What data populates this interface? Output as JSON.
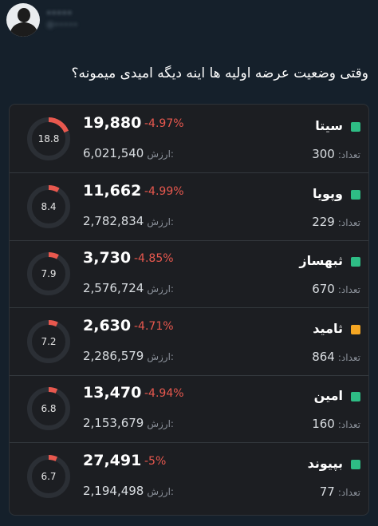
{
  "post": {
    "author_name": "•••••",
    "author_handle": "@•••••",
    "text": "وقتی وضعیت عرضه اولیه ها اینه دیگه امیدی میمونه؟"
  },
  "labels": {
    "value": "ارزش:",
    "count": "تعداد:"
  },
  "colors": {
    "green": "#2ebd85",
    "orange": "#f5a623",
    "red": "#e8584e",
    "track": "#2b2f35"
  },
  "stocks": [
    {
      "name": "سیتا",
      "status": "green",
      "price": "19,880",
      "change": "-4.97%",
      "value": "6,021,540",
      "count": "300",
      "gauge_text": "18.8",
      "gauge_level": 18.8
    },
    {
      "name": "وپویا",
      "status": "green",
      "price": "11,662",
      "change": "-4.99%",
      "value": "2,782,834",
      "count": "229",
      "gauge_text": "8.4",
      "gauge_level": 8.4
    },
    {
      "name": "ثبهساز",
      "status": "green",
      "price": "3,730",
      "change": "-4.85%",
      "value": "2,576,724",
      "count": "670",
      "gauge_text": "7.9",
      "gauge_level": 7.9
    },
    {
      "name": "ثامید",
      "status": "orange",
      "price": "2,630",
      "change": "-4.71%",
      "value": "2,286,579",
      "count": "864",
      "gauge_text": "7.2",
      "gauge_level": 7.2
    },
    {
      "name": "امین",
      "status": "green",
      "price": "13,470",
      "change": "-4.94%",
      "value": "2,153,679",
      "count": "160",
      "gauge_text": "6.8",
      "gauge_level": 6.8
    },
    {
      "name": "بپیوند",
      "status": "green",
      "price": "27,491",
      "change": "-5%",
      "value": "2,194,498",
      "count": "77",
      "gauge_text": "6.7",
      "gauge_level": 6.7
    }
  ]
}
